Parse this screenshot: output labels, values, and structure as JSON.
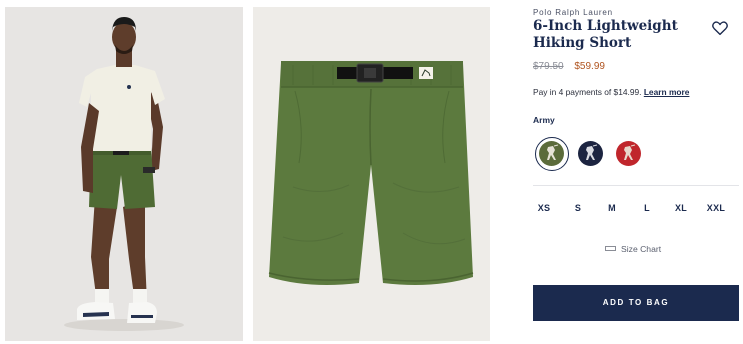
{
  "product": {
    "brand": "Polo Ralph Lauren",
    "title": "6-Inch Lightweight Hiking Short",
    "price_original": "$79.50",
    "price_sale": "$59.99",
    "payments_text": "Pay in 4 payments of $14.99.",
    "payments_link": "Learn more",
    "color_label": "Army",
    "swatches": [
      {
        "name": "Army",
        "color": "#5b6b3a",
        "pony_color": "#e6e2d6",
        "selected": true
      },
      {
        "name": "Navy",
        "color": "#1c2440",
        "pony_color": "#d9dbe2",
        "selected": false
      },
      {
        "name": "Red",
        "color": "#c0262c",
        "pony_color": "#e8d8cc",
        "selected": false
      }
    ],
    "sizes": [
      "XS",
      "S",
      "M",
      "L",
      "XL",
      "XXL"
    ],
    "size_chart_label": "Size Chart",
    "add_to_bag": "ADD TO BAG"
  },
  "colors": {
    "navy": "#1b2a4e",
    "sale": "#b0541f",
    "short_green": "#5c7a3e"
  },
  "icons": {
    "wishlist": "heart-outline-icon",
    "size_chart": "ruler-icon"
  }
}
